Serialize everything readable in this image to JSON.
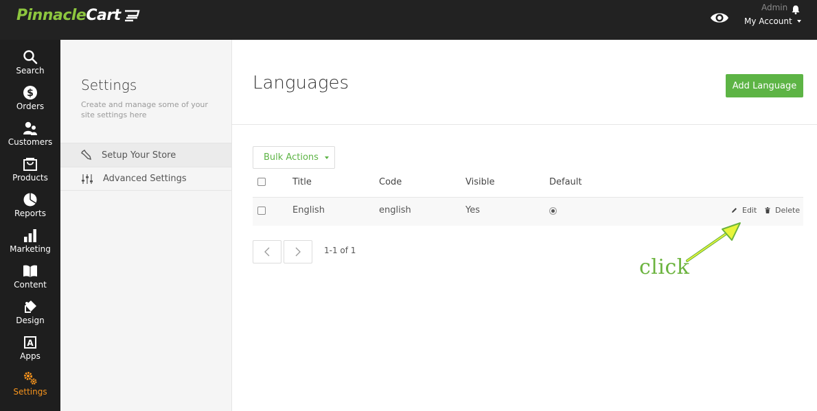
{
  "brand": {
    "part1": "Pinnacle",
    "part2": "Cart"
  },
  "topbar": {
    "admin_label": "Admin",
    "account_label": "My Account"
  },
  "rail": {
    "items": [
      {
        "label": "Search",
        "icon": "search-icon"
      },
      {
        "label": "Orders",
        "icon": "dollar-circle-icon"
      },
      {
        "label": "Customers",
        "icon": "users-icon"
      },
      {
        "label": "Products",
        "icon": "bag-icon"
      },
      {
        "label": "Reports",
        "icon": "pie-chart-icon"
      },
      {
        "label": "Marketing",
        "icon": "bar-chart-icon"
      },
      {
        "label": "Content",
        "icon": "book-icon"
      },
      {
        "label": "Design",
        "icon": "paint-bucket-icon"
      },
      {
        "label": "Apps",
        "icon": "apps-icon"
      },
      {
        "label": "Settings",
        "icon": "gears-icon"
      }
    ],
    "active": "Settings"
  },
  "settings_panel": {
    "title": "Settings",
    "description": "Create and manage some of your site settings here",
    "items": [
      {
        "label": "Setup Your Store",
        "icon": "wrench-icon"
      },
      {
        "label": "Advanced Settings",
        "icon": "sliders-icon"
      }
    ]
  },
  "main": {
    "title": "Languages",
    "add_button": "Add Language",
    "bulk_actions": "Bulk Actions",
    "table": {
      "headers": [
        "Title",
        "Code",
        "Visible",
        "Default"
      ],
      "rows": [
        {
          "title": "English",
          "code": "english",
          "visible": "Yes",
          "default": true
        }
      ],
      "actions": {
        "edit": "Edit",
        "delete": "Delete"
      }
    },
    "pagination": {
      "summary": "1-1 of 1"
    }
  },
  "annotation": {
    "text": "click"
  },
  "colors": {
    "topbar": "#222222",
    "rail": "#1e1e1e",
    "accent_green": "#5db445",
    "active_orange": "#f7941d",
    "annotation": "#6bb33e"
  }
}
